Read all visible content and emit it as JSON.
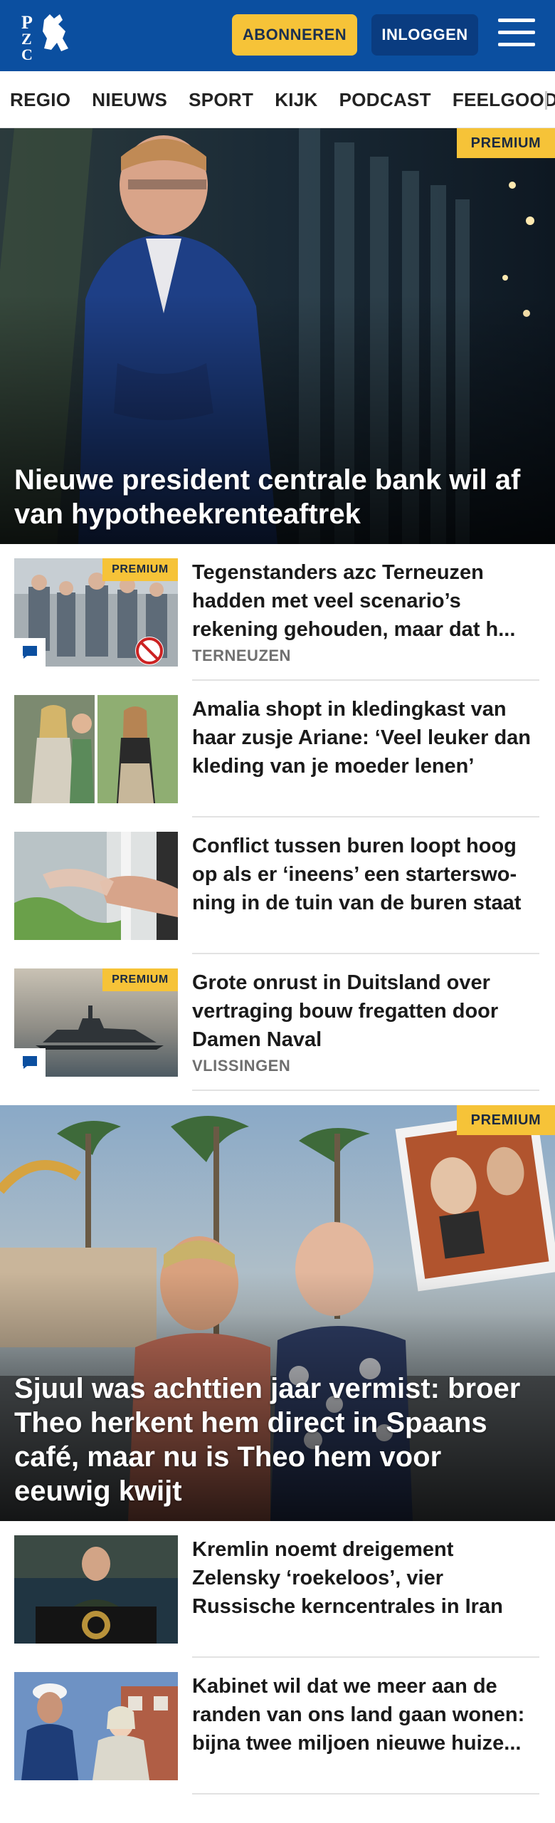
{
  "header": {
    "logo_text": "PZC",
    "subscribe_label": "ABONNEREN",
    "login_label": "INLOGGEN",
    "menu_icon": "hamburger-menu-icon",
    "brand_color": "#0b4fa0",
    "accent_color": "#f6c338"
  },
  "nav": {
    "items": [
      {
        "label": "REGIO"
      },
      {
        "label": "NIEUWS"
      },
      {
        "label": "SPORT"
      },
      {
        "label": "KIJK"
      },
      {
        "label": "PODCAST"
      },
      {
        "label": "FEELGOOD"
      }
    ]
  },
  "hero1": {
    "badge": "PREMIUM",
    "title": "Nieuwe president centrale bank wil af van hypotheekrenteaftrek"
  },
  "articles": [
    {
      "badge": "PREMIUM",
      "title": "Tegenstanders azc Terneuzen hadden met veel scenario’s rekening gehouden, maar dat h...",
      "category": "TERNEUZEN",
      "has_comment_icon": true
    },
    {
      "title": "Amalia shopt in kledingkast van haar zusje Ariane: ‘Veel leuker dan kleding van je moeder lenen’"
    },
    {
      "title": "Conflict tussen buren loopt hoog op als er ‘ineens’ een starterswo­ning in de tuin van de buren staat"
    },
    {
      "badge": "PREMIUM",
      "title": "Grote onrust in Duitsland over vertraging bouw fregatten door Damen Naval",
      "category": "VLISSINGEN",
      "has_comment_icon": true
    }
  ],
  "hero2": {
    "badge": "PREMIUM",
    "title": "Sjuul was achttien jaar vermist: broer Theo herkent hem direct in Spaans café, maar nu is Theo hem voor eeuwig kwijt"
  },
  "articles2": [
    {
      "title": "Kremlin noemt dreigement Zelensky ‘roekeloos’, vier Russische kerncentrales in Iran"
    },
    {
      "title": "Kabinet wil dat we meer aan de randen van ons land gaan wonen: bijna twee miljoen nieuwe huize..."
    }
  ]
}
